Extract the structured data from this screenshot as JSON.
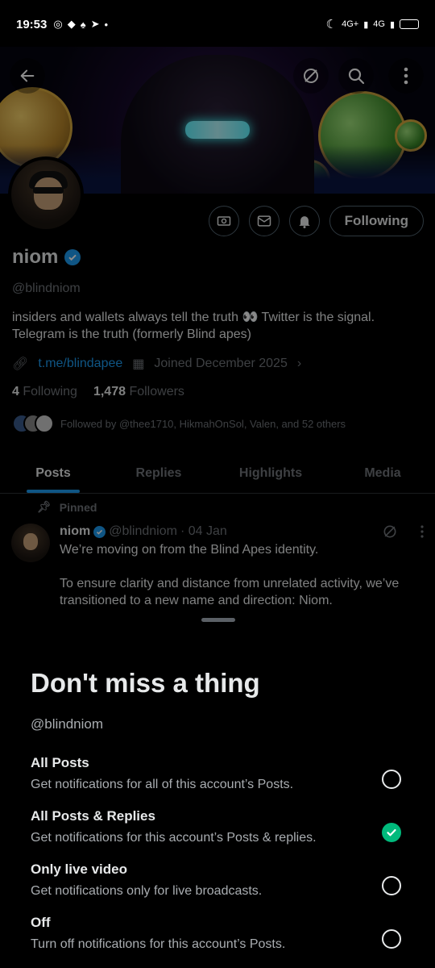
{
  "status_bar": {
    "time": "19:53",
    "network_label_1": "4G+",
    "network_label_2": "4G",
    "battery_level": 0.4
  },
  "profile": {
    "name": "niom",
    "handle": "@blindniom",
    "bio": "insiders and wallets always tell the truth 👀 Twitter is the signal. Telegram is the truth (formerly Blind apes)",
    "link": "t.me/blindapee",
    "joined": "Joined December 2025",
    "following_count": "4",
    "following_label": "Following",
    "followers_count": "1,478",
    "followers_label": "Followers",
    "followed_by": "Followed by @thee1710, HikmahOnSol, Valen, and 52 others",
    "follow_button": "Following"
  },
  "tabs": [
    {
      "label": "Posts"
    },
    {
      "label": "Replies"
    },
    {
      "label": "Highlights"
    },
    {
      "label": "Media"
    }
  ],
  "pinned_post": {
    "pinned_label": "Pinned",
    "author_name": "niom",
    "author_handle": "@blindniom",
    "date": "· 04 Jan",
    "text_1": "We’re moving on from the Blind Apes identity.",
    "text_2": "To ensure clarity and distance from unrelated activity, we’ve transitioned to a new name and direction: Niom."
  },
  "notification_sheet": {
    "title": "Don't miss a thing",
    "handle": "@blindniom",
    "options": [
      {
        "title": "All Posts",
        "desc": "Get notifications for all of this account’s Posts.",
        "selected": false
      },
      {
        "title": "All Posts & Replies",
        "desc": "Get notifications for this account’s Posts & replies.",
        "selected": true
      },
      {
        "title": "Only live video",
        "desc": "Get notifications only for live broadcasts.",
        "selected": false
      },
      {
        "title": "Off",
        "desc": "Turn off notifications for this account’s Posts.",
        "selected": false
      }
    ]
  },
  "colors": {
    "accent": "#1d9bf0",
    "selected": "#00ba7c",
    "muted": "#71767b",
    "background": "#000000"
  }
}
